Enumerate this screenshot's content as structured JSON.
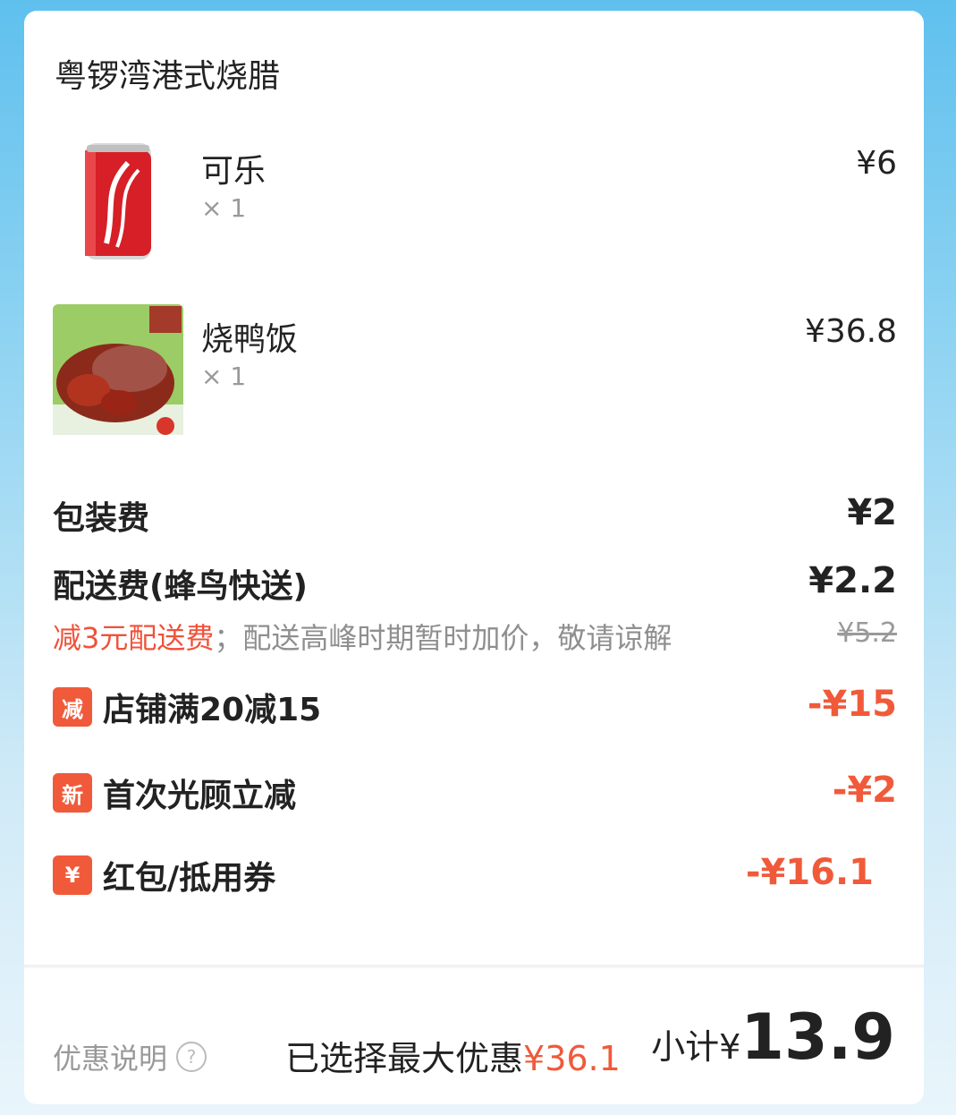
{
  "shop": {
    "name": "粤锣湾港式烧腊"
  },
  "items": [
    {
      "name": "可乐",
      "qty": "× 1",
      "price": "¥6",
      "image": "cola-can"
    },
    {
      "name": "烧鸭饭",
      "qty": "× 1",
      "price": "¥36.8",
      "image": "roast-duck"
    }
  ],
  "fees": {
    "packaging": {
      "label": "包装费",
      "value": "¥2"
    },
    "delivery": {
      "label": "配送费(蜂鸟快送)",
      "value": "¥2.2",
      "note_red": "减3元配送费",
      "note_gray": "；配送高峰时期暂时加价，敬请谅解",
      "original": "¥5.2"
    }
  },
  "discounts": [
    {
      "badge": "减",
      "label": "店铺满20减15",
      "value": "-¥15"
    },
    {
      "badge": "新",
      "label": "首次光顾立减",
      "value": "-¥2"
    },
    {
      "badge": "¥",
      "label": "红包/抵用券",
      "value": "-¥16.1"
    }
  ],
  "footer": {
    "help_label": "优惠说明",
    "help_icon": "question-circle-icon",
    "max_discount_label": "已选择最大优惠",
    "max_discount_value": "¥36.1",
    "subtotal_label": "小计¥",
    "subtotal_value": "13.9"
  },
  "colors": {
    "accent": "#f05a3a",
    "background_top": "#5fc0ee",
    "card": "#ffffff"
  }
}
